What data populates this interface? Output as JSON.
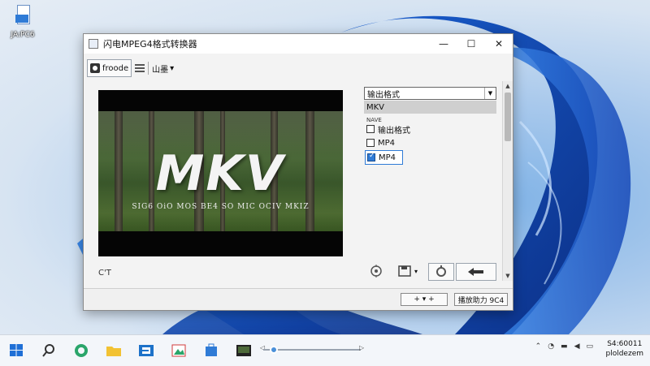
{
  "desktop": {
    "icon_label": "JA:PC6"
  },
  "window": {
    "title": "闪电MPEG4格式转换器",
    "controls": {
      "minimize": "—",
      "maximize": "☐",
      "close": "✕"
    },
    "toolbar": {
      "btn1_label": "froode",
      "btn2_label": "山墨"
    },
    "preview": {
      "title_text": "MKV",
      "subtitle_text": "SIG6 OiO MOS BE4 SO MIC OCIV MKIZ"
    },
    "format_select": {
      "label": "输出格式",
      "dropdown_arrow": "▼",
      "selected_option": "MKV",
      "sub_option": "NAVE"
    },
    "checkboxes": [
      {
        "label": "输出格式",
        "checked": false
      },
      {
        "label": "MP4",
        "checked": false
      },
      {
        "label": "MP4",
        "checked": true
      }
    ],
    "counter": "C'T",
    "statusbar": {
      "left_box": "+ ▾ +",
      "right_box": "播放助力 9C4"
    }
  },
  "taskbar": {
    "media_left": "◁",
    "media_right": "▷",
    "clock": {
      "time": "S4:60011",
      "date": "ploldezem"
    }
  },
  "colors": {
    "accent": "#2f7bd6",
    "window_bg": "#f3f3f3",
    "taskbar_bg": "#f3f6fa"
  }
}
